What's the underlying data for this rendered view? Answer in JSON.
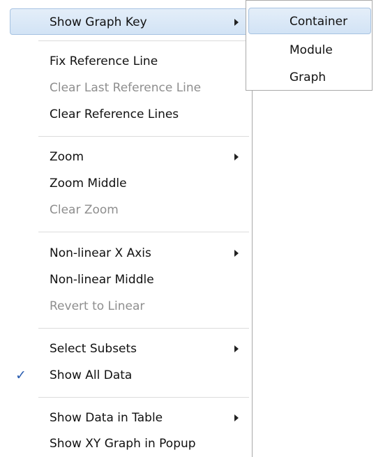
{
  "menu": {
    "items": [
      {
        "label": "Show Graph Key",
        "submenu": true,
        "highlighted": true
      },
      {
        "label": "Fix Reference Line"
      },
      {
        "label": "Clear Last Reference Line",
        "disabled": true
      },
      {
        "label": "Clear Reference Lines"
      },
      {
        "label": "Zoom",
        "submenu": true
      },
      {
        "label": "Zoom Middle"
      },
      {
        "label": "Clear Zoom",
        "disabled": true
      },
      {
        "label": "Non-linear X Axis",
        "submenu": true
      },
      {
        "label": "Non-linear Middle"
      },
      {
        "label": "Revert to Linear",
        "disabled": true
      },
      {
        "label": "Select Subsets",
        "submenu": true
      },
      {
        "label": "Show All Data",
        "checked": true
      },
      {
        "label": "Show Data in Table",
        "submenu": true
      },
      {
        "label": "Show XY Graph in Popup"
      }
    ],
    "checkmark": "✓"
  },
  "submenu": {
    "items": [
      {
        "label": "Container",
        "highlighted": true
      },
      {
        "label": "Module"
      },
      {
        "label": "Graph"
      }
    ]
  },
  "colors": {
    "highlight_fill": "#d9e7f7",
    "highlight_border": "#a7c3e2",
    "disabled_text": "#8e8e8e",
    "checkmark": "#2a5db0"
  }
}
